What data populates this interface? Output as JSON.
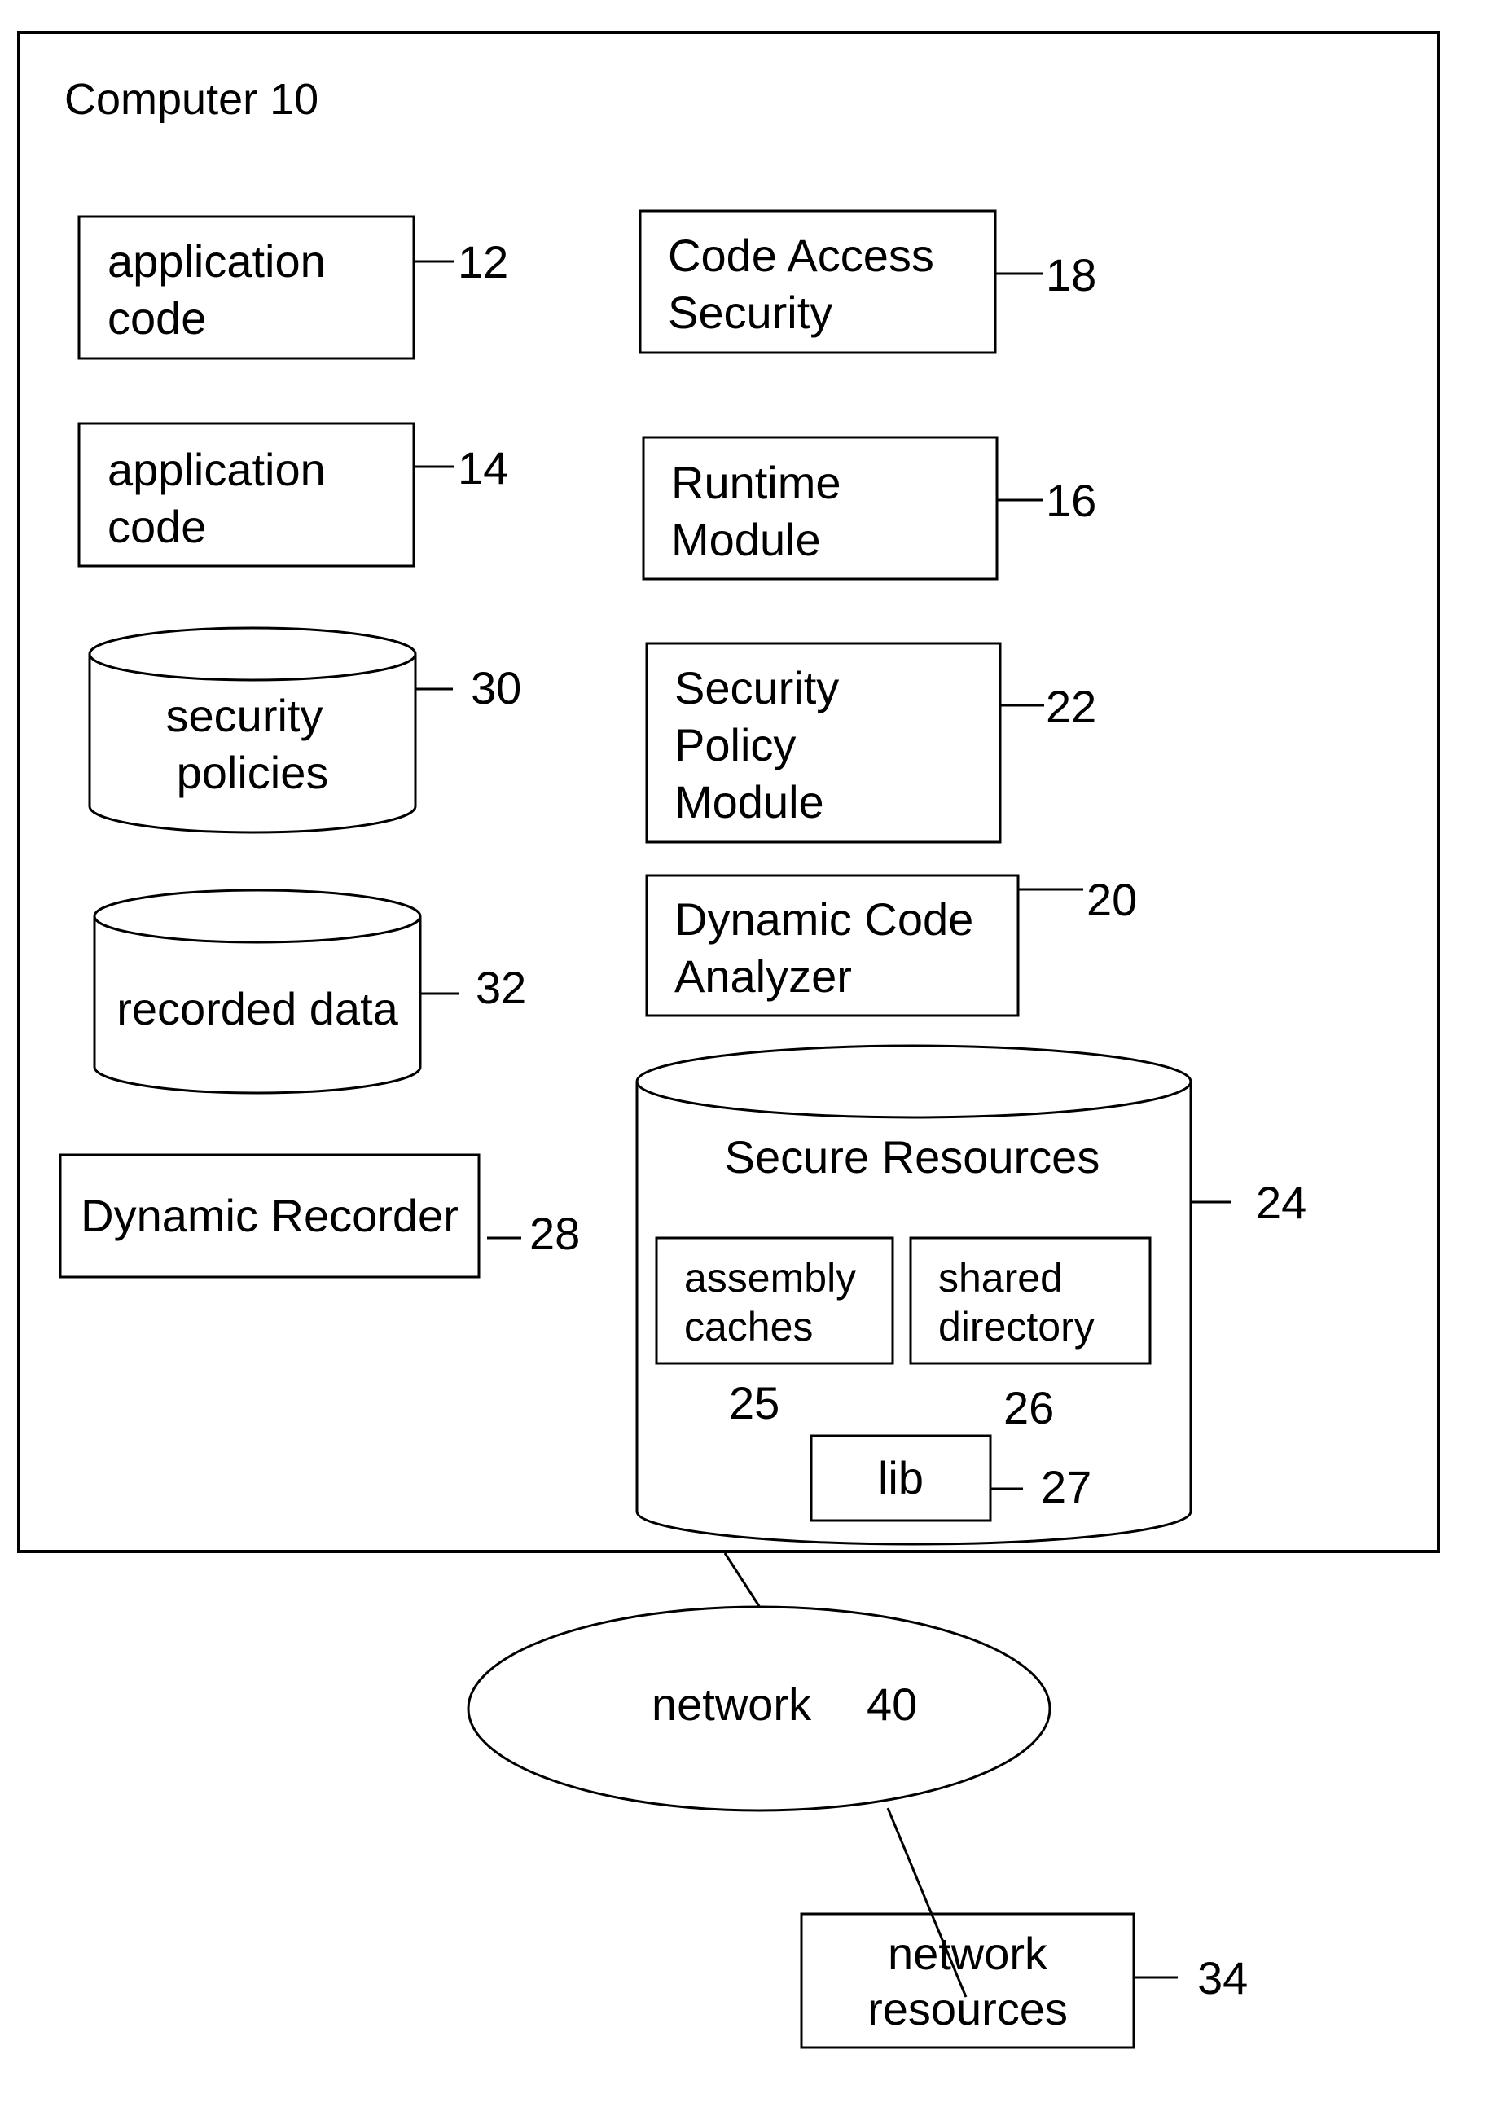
{
  "diagram": {
    "container": {
      "label": "Computer 10"
    },
    "components": {
      "app_code_12": {
        "lines": [
          "application",
          "code"
        ],
        "ref": "12"
      },
      "app_code_14": {
        "lines": [
          "application",
          "code"
        ],
        "ref": "14"
      },
      "security_policies": {
        "lines": [
          "security",
          "policies"
        ],
        "ref": "30"
      },
      "recorded_data": {
        "lines": [
          "recorded data"
        ],
        "ref": "32"
      },
      "dynamic_recorder": {
        "lines": [
          "Dynamic Recorder"
        ],
        "ref": "28"
      },
      "code_access_security": {
        "lines": [
          "Code Access",
          "Security"
        ],
        "ref": "18"
      },
      "runtime_module": {
        "lines": [
          "Runtime",
          "Module"
        ],
        "ref": "16"
      },
      "security_policy_module": {
        "lines": [
          "Security",
          "Policy",
          "Module"
        ],
        "ref": "22"
      },
      "dynamic_code_analyzer": {
        "lines": [
          "Dynamic Code",
          "Analyzer"
        ],
        "ref": "20"
      },
      "secure_resources": {
        "title": "Secure Resources",
        "ref": "24",
        "assembly_caches": {
          "lines": [
            "assembly",
            "caches"
          ],
          "ref": "25"
        },
        "shared_directory": {
          "lines": [
            "shared",
            "directory"
          ],
          "ref": "26"
        },
        "lib": {
          "lines": [
            "lib"
          ],
          "ref": "27"
        }
      },
      "network": {
        "label": "network",
        "ref": "40"
      },
      "network_resources": {
        "lines": [
          "network",
          "resources"
        ],
        "ref": "34"
      }
    }
  }
}
